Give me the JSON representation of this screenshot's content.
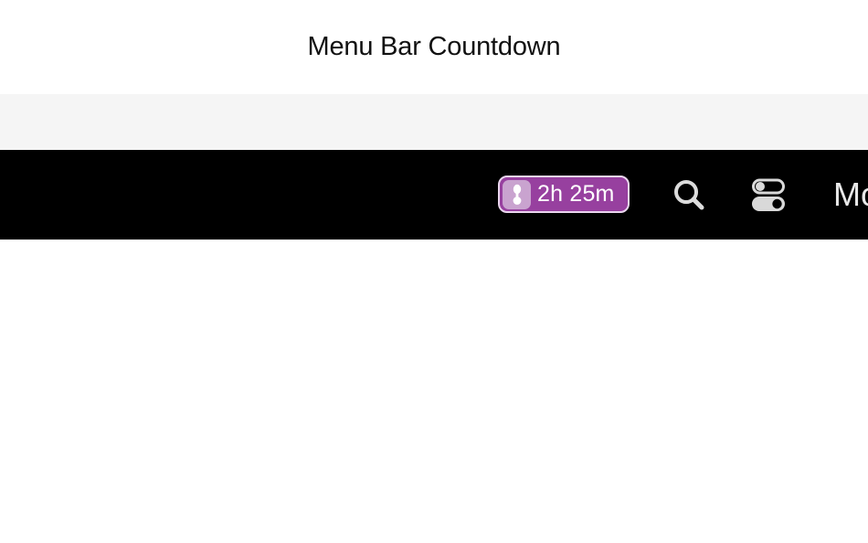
{
  "page": {
    "title": "Menu Bar Countdown"
  },
  "menubar": {
    "countdown": {
      "text": "2h 25m",
      "icon": "hourglass-icon",
      "pill_color": "#97409f",
      "icon_bg_color": "#c9a3cf"
    },
    "icons": [
      "search-icon",
      "control-center-icon"
    ],
    "partial_item_text": "Mo"
  }
}
